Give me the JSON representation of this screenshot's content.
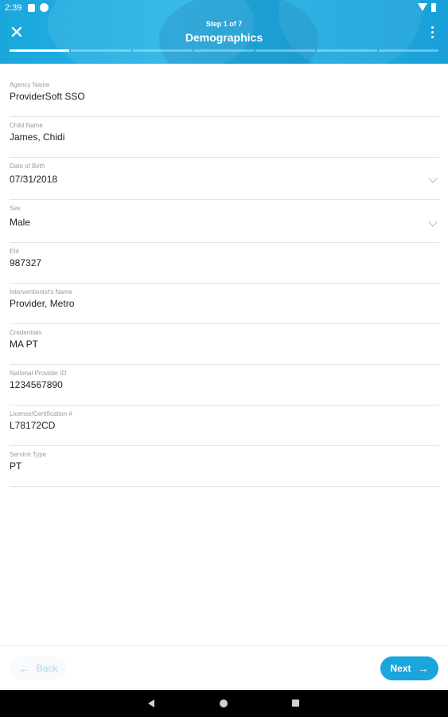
{
  "status_bar": {
    "time": "2:39"
  },
  "header": {
    "step_label": "Step 1 of 7",
    "title": "Demographics",
    "close_icon": "close-icon",
    "menu_icon": "more-vertical-icon",
    "steps_total": 7,
    "current_step": 1
  },
  "form": {
    "fields": [
      {
        "label": "Agency Name",
        "value": "ProviderSoft SSO"
      },
      {
        "label": "Child Name",
        "value": "James, Chidi"
      },
      {
        "label": "Date of Birth",
        "value": "07/31/2018",
        "dropdown": true
      },
      {
        "label": "Sex",
        "value": "Male",
        "dropdown": true
      },
      {
        "label": "EI#",
        "value": "987327"
      },
      {
        "label": "Interventionist's Name",
        "value": "Provider, Metro"
      },
      {
        "label": "Credentials",
        "value": "MA PT"
      },
      {
        "label": "National Provider ID",
        "value": "1234567890"
      },
      {
        "label": "License/Certification #",
        "value": "L78172CD"
      },
      {
        "label": "Service Type",
        "value": "PT"
      }
    ]
  },
  "footer": {
    "back_label": "Back",
    "next_label": "Next",
    "back_icon": "arrow-left-icon",
    "next_icon": "arrow-right-icon"
  },
  "colors": {
    "accent": "#1aa5dc",
    "header": "#29b3e6",
    "back_text": "#a9d8ee"
  }
}
